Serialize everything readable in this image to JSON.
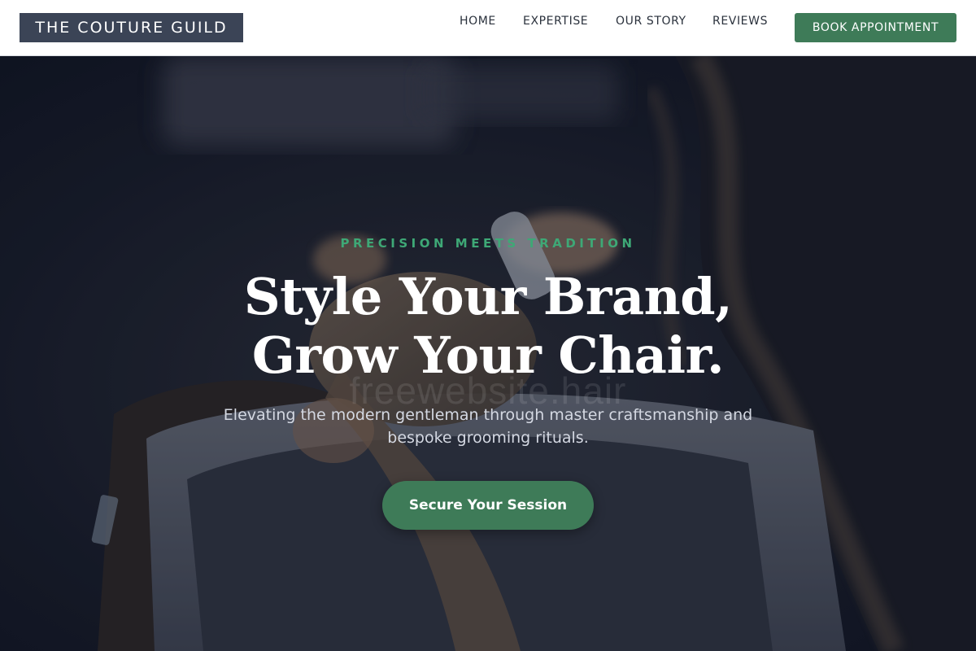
{
  "brand": {
    "name": "THE COUTURE GUILD"
  },
  "nav": {
    "items": [
      {
        "label": "HOME"
      },
      {
        "label": "EXPERTISE"
      },
      {
        "label": "OUR STORY"
      },
      {
        "label": "REVIEWS"
      }
    ],
    "cta_label": "BOOK APPOINTMENT"
  },
  "hero": {
    "eyebrow": "PRECISION MEETS TRADITION",
    "headline_line1": "Style Your Brand,",
    "headline_line2": "Grow Your Chair.",
    "watermark": "freewebsite.hair",
    "subtext": "Elevating the modern gentleman through master craftsmanship and bespoke grooming rituals.",
    "cta_label": "Secure Your Session",
    "background_image": "salon-hair-wash-photo"
  },
  "colors": {
    "accent_green": "#3e7b58",
    "eyebrow_green": "#3ea876",
    "logo_bg": "#3b4456",
    "hero_bg": "#101522"
  }
}
